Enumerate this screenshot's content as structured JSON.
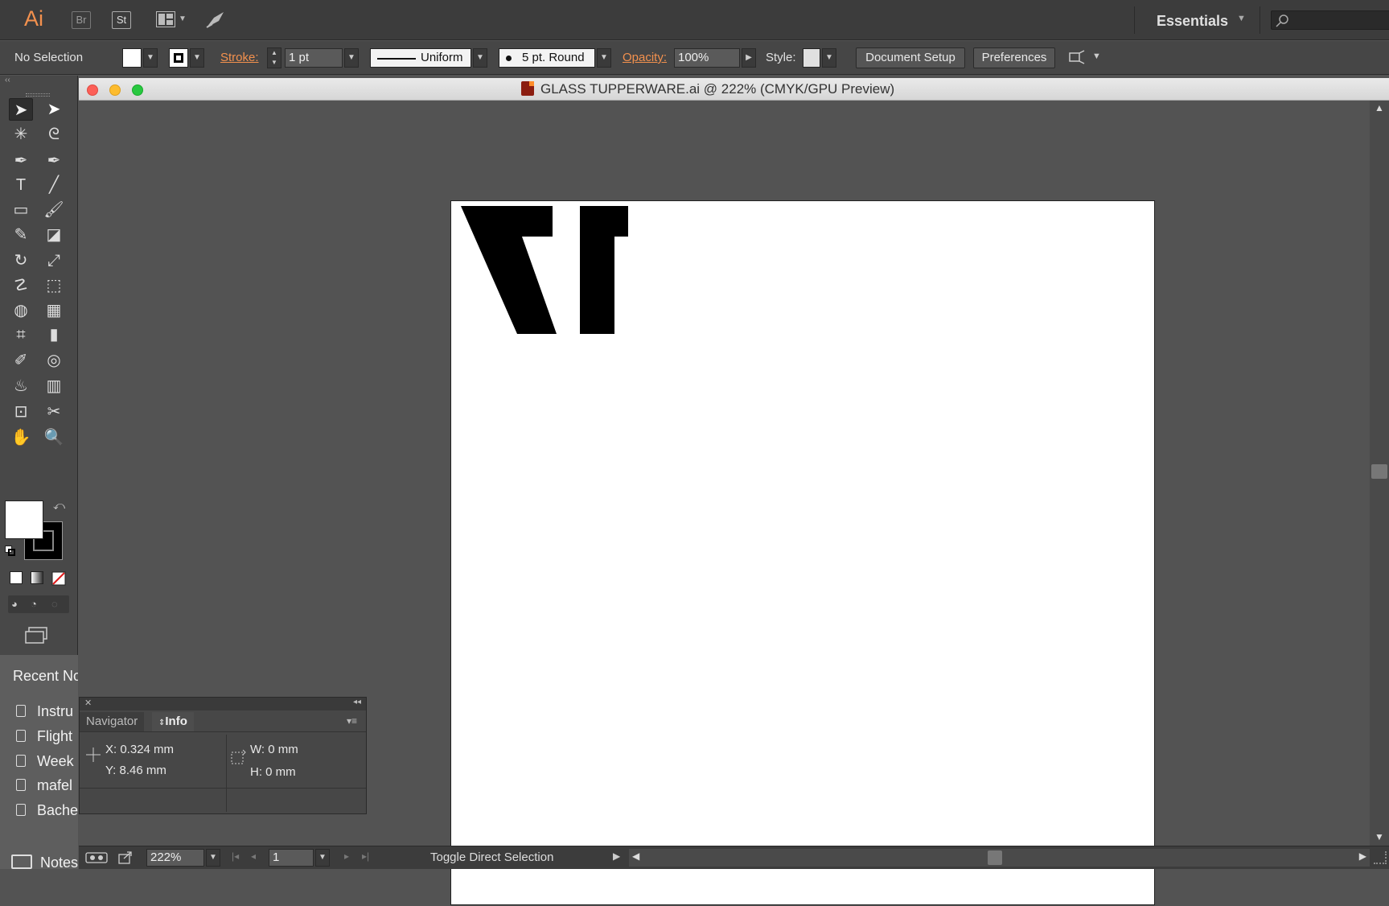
{
  "app": {
    "logo": "Ai",
    "buttons": [
      "Br",
      "St"
    ],
    "workspace": "Essentials"
  },
  "control_bar": {
    "selection": "No Selection",
    "stroke_label": "Stroke:",
    "stroke_weight": "1 pt",
    "profile": "Uniform",
    "brush": "5 pt. Round",
    "opacity_label": "Opacity:",
    "opacity_value": "100%",
    "style_label": "Style:",
    "document_setup": "Document Setup",
    "preferences": "Preferences"
  },
  "document": {
    "title": "GLASS TUPPERWARE.ai @ 222% (CMYK/GPU Preview)"
  },
  "info_panel": {
    "tabs": [
      "Navigator",
      "Info"
    ],
    "x": "X:  0.324 mm",
    "y": "Y:  8.46 mm",
    "w": "W:  0 mm",
    "h": "H:  0 mm"
  },
  "status_bar": {
    "zoom": "222%",
    "page": "1",
    "tool_status": "Toggle Direct Selection"
  },
  "recent_notes": {
    "header": "Recent No",
    "items": [
      "Instru",
      "Flight",
      "Week",
      "mafel",
      "Bache"
    ],
    "footer": "Notes"
  },
  "tools": [
    "selection-tool",
    "direct-selection-tool",
    "magic-wand-tool",
    "lasso-tool",
    "pen-tool",
    "curvature-tool",
    "type-tool",
    "line-tool",
    "rectangle-tool",
    "paintbrush-tool",
    "pencil-tool",
    "eraser-tool",
    "rotate-tool",
    "scale-tool",
    "warp-tool",
    "free-transform-tool",
    "shape-builder-tool",
    "perspective-grid-tool",
    "mesh-tool",
    "gradient-tool",
    "eyedropper-tool",
    "blend-tool",
    "symbol-sprayer-tool",
    "column-graph-tool",
    "artboard-tool",
    "slice-tool",
    "hand-tool",
    "zoom-tool"
  ],
  "colors": {
    "accent": "#f3914e",
    "ui_dark": "#3c3c3c",
    "canvas": "#535353"
  }
}
